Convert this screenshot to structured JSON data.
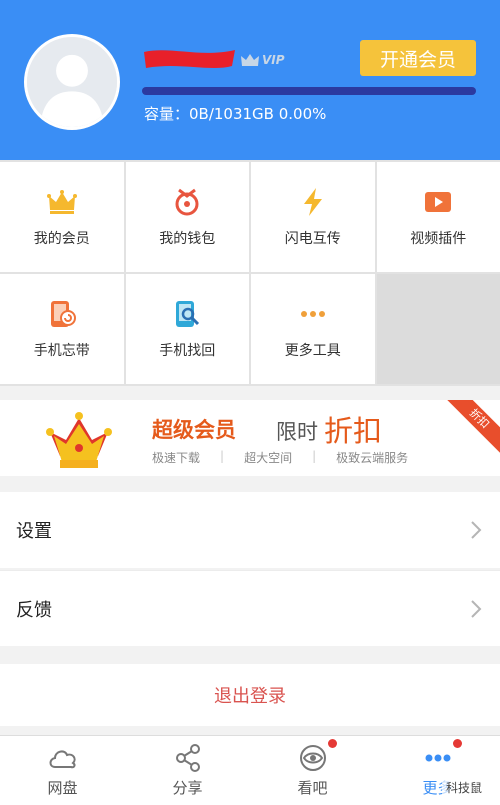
{
  "header": {
    "vip_tag": "VIP",
    "open_vip_label": "开通会员",
    "capacity_label": "容量：0B/1031GB 0.00%",
    "capacity_fraction": 0.0,
    "accent_color": "#3a8ef5"
  },
  "grid": {
    "items": [
      {
        "label": "我的会员",
        "icon": "crown-icon"
      },
      {
        "label": "我的钱包",
        "icon": "wallet-icon"
      },
      {
        "label": "闪电互传",
        "icon": "lightning-icon"
      },
      {
        "label": "视频插件",
        "icon": "video-plugin-icon"
      },
      {
        "label": "手机忘带",
        "icon": "phone-forgot-icon"
      },
      {
        "label": "手机找回",
        "icon": "phone-find-icon"
      },
      {
        "label": "更多工具",
        "icon": "more-dots-icon"
      }
    ]
  },
  "banner": {
    "title": "超级会员",
    "subtitle_1": "限时",
    "subtitle_2": "折扣",
    "features": [
      "极速下载",
      "超大空间",
      "极致云端服务"
    ],
    "ribbon": "折扣"
  },
  "settings": {
    "settings_label": "设置",
    "feedback_label": "反馈",
    "logout_label": "退出登录"
  },
  "tabs": [
    {
      "label": "网盘",
      "icon": "cloud-icon"
    },
    {
      "label": "分享",
      "icon": "share-icon"
    },
    {
      "label": "看吧",
      "icon": "eye-icon"
    },
    {
      "label": "更多",
      "icon": "more-icon"
    }
  ],
  "watermark": "科技鼠"
}
